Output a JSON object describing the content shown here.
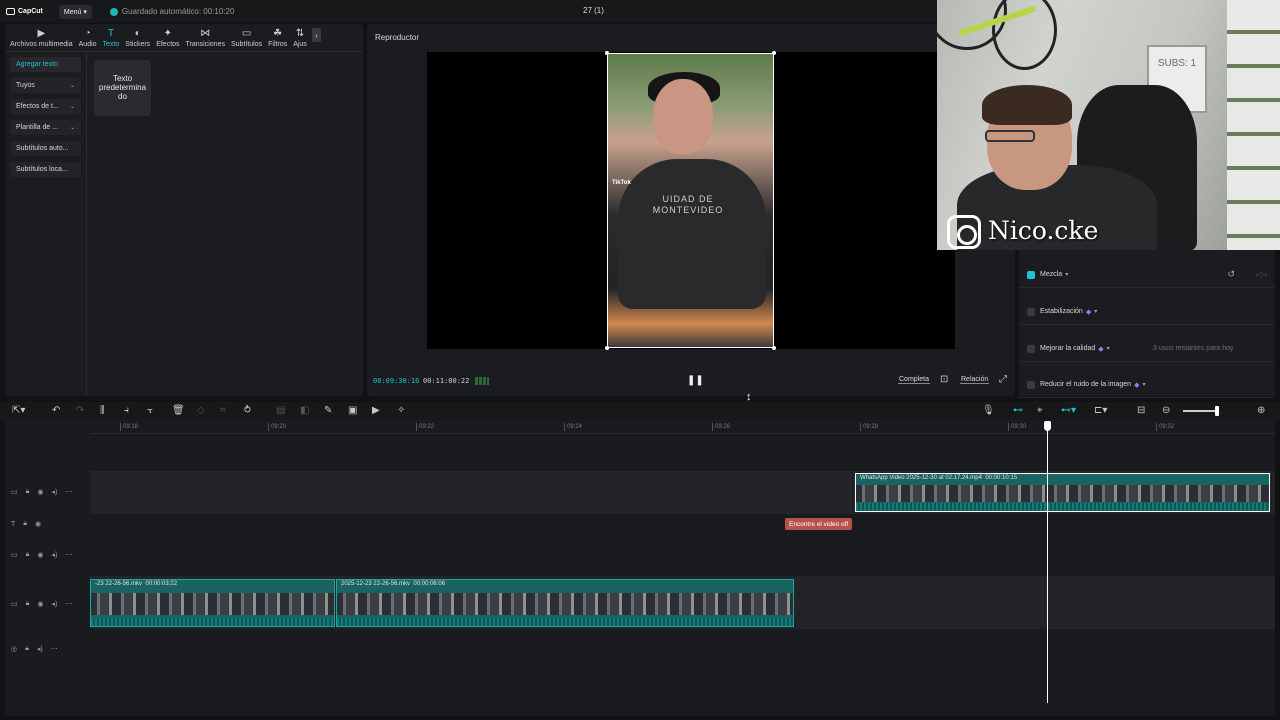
{
  "app": {
    "logo": "CapCut",
    "menu_label": "Menú",
    "autosave": "Guardado automático: 00:10:20",
    "project_title": "27 (1)"
  },
  "tabs": [
    {
      "label": "Archivos multimedia",
      "icon": "media-icon",
      "glyph": "▶"
    },
    {
      "label": "Audio",
      "icon": "audio-icon",
      "glyph": "◔"
    },
    {
      "label": "Texto",
      "icon": "text-icon",
      "glyph": "T",
      "active": true
    },
    {
      "label": "Stickers",
      "icon": "sticker-icon",
      "glyph": "◐"
    },
    {
      "label": "Efectos",
      "icon": "effects-icon",
      "glyph": "✦"
    },
    {
      "label": "Transiciones",
      "icon": "transitions-icon",
      "glyph": "⋈"
    },
    {
      "label": "Subtítulos",
      "icon": "subtitles-icon",
      "glyph": "▭"
    },
    {
      "label": "Filtros",
      "icon": "filters-icon",
      "glyph": "☘"
    },
    {
      "label": "Ajus",
      "icon": "adjust-icon",
      "glyph": "⇅"
    }
  ],
  "side_menu": [
    {
      "label": "Agregar texto",
      "active": true,
      "has_chevron": false
    },
    {
      "label": "Tuyos",
      "has_chevron": true
    },
    {
      "label": "Efectos de t...",
      "has_chevron": true
    },
    {
      "label": "Plantilla de ...",
      "has_chevron": true
    },
    {
      "label": "Subtítulos auto...",
      "has_chevron": false
    },
    {
      "label": "Subtítulos loca...",
      "has_chevron": false
    }
  ],
  "default_text_card": "Texto predetermina do",
  "player": {
    "title": "Reproductor",
    "timecode_current": "00:09:30:16",
    "timecode_total": "00:11:00:22",
    "full_label": "Completa",
    "ratio_label": "Relación",
    "video_overlay_text": "UIDAD DE MONTEVIDEO",
    "tiktok_label": "TikTok"
  },
  "webcam": {
    "handle": "Nico.cke",
    "board_text": "SUBS: 1"
  },
  "properties": [
    {
      "label": "Mezcla",
      "checked": true,
      "gem": false,
      "usage": ""
    },
    {
      "label": "Estabilización",
      "checked": false,
      "gem": true,
      "usage": ""
    },
    {
      "label": "Mejorar la calidad",
      "checked": false,
      "gem": true,
      "usage": "3 usos restantes para hoy"
    },
    {
      "label": "Reducir el ruido de la imagen",
      "checked": false,
      "gem": true,
      "usage": ""
    }
  ],
  "ruler_ticks": [
    "09:18",
    "09:20",
    "09:22",
    "09:24",
    "09:26",
    "09:28",
    "09:30",
    "09:32"
  ],
  "clips": {
    "upper": {
      "label": "WhatsApp Video 2025-12-30 at 02.17.24.mp4",
      "duration": "00:00:10:15"
    },
    "text": {
      "label": "Encontre el video off"
    },
    "main_a": {
      "label": "-23 22-26-56.mkv",
      "duration": "00:00:03:22"
    },
    "main_b": {
      "label": "2025-12-23 22-26-56.mkv",
      "duration": "00:00:06:06"
    }
  }
}
